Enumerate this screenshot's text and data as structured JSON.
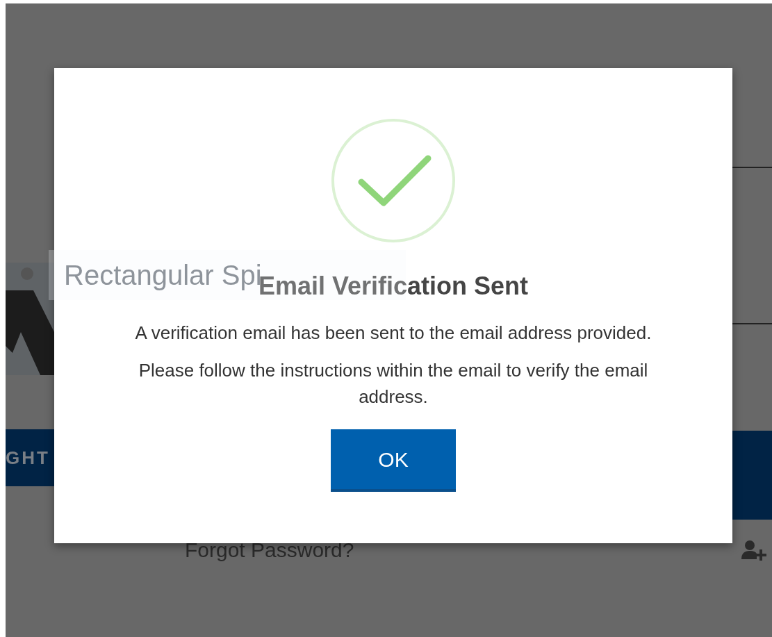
{
  "background": {
    "hover_label": "Rectangular Spi",
    "banner_text": "GHT",
    "forgot_link": "Forgot Password?"
  },
  "dialog": {
    "title": "Email Verification Sent",
    "messages": [
      "A verification email has been sent to the email address provided.",
      "Please follow the instructions within the email to verify the email address."
    ],
    "button": "OK"
  }
}
